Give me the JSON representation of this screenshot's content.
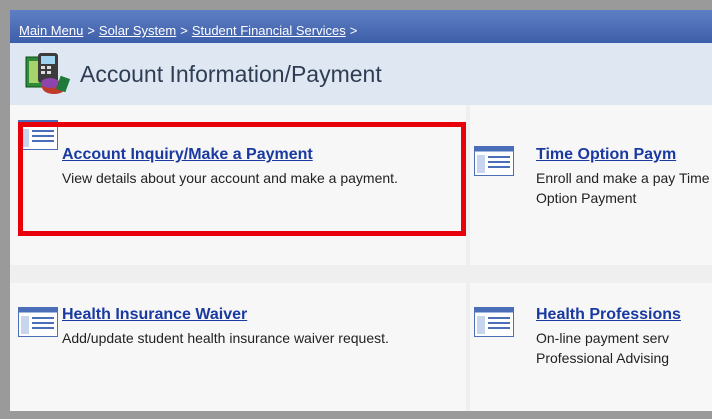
{
  "breadcrumb": {
    "items": [
      "Main Menu",
      "Solar System",
      "Student Financial Services"
    ],
    "separator": ">"
  },
  "header": {
    "title": "Account Information/Payment",
    "icon": "financial-account-icon"
  },
  "tiles": [
    {
      "title": "Account Inquiry/Make a Payment",
      "description": "View details about your account and make a payment.",
      "icon": "menu-page-icon",
      "highlighted": true
    },
    {
      "title": "Time Option Paym",
      "description": "Enroll and make a pay Time Option Payment",
      "icon": "menu-page-icon"
    },
    {
      "title": "Health Insurance Waiver",
      "description": "Add/update student health insurance waiver request.",
      "icon": "menu-page-icon"
    },
    {
      "title": "Health Professions",
      "description": "On-line payment serv Professional Advising",
      "icon": "menu-page-icon"
    }
  ],
  "colors": {
    "breadcrumb_bar": "#4a6cb6",
    "header_bg": "#dfe7f3",
    "link": "#1a3aa0",
    "highlight": "#e8000b"
  }
}
